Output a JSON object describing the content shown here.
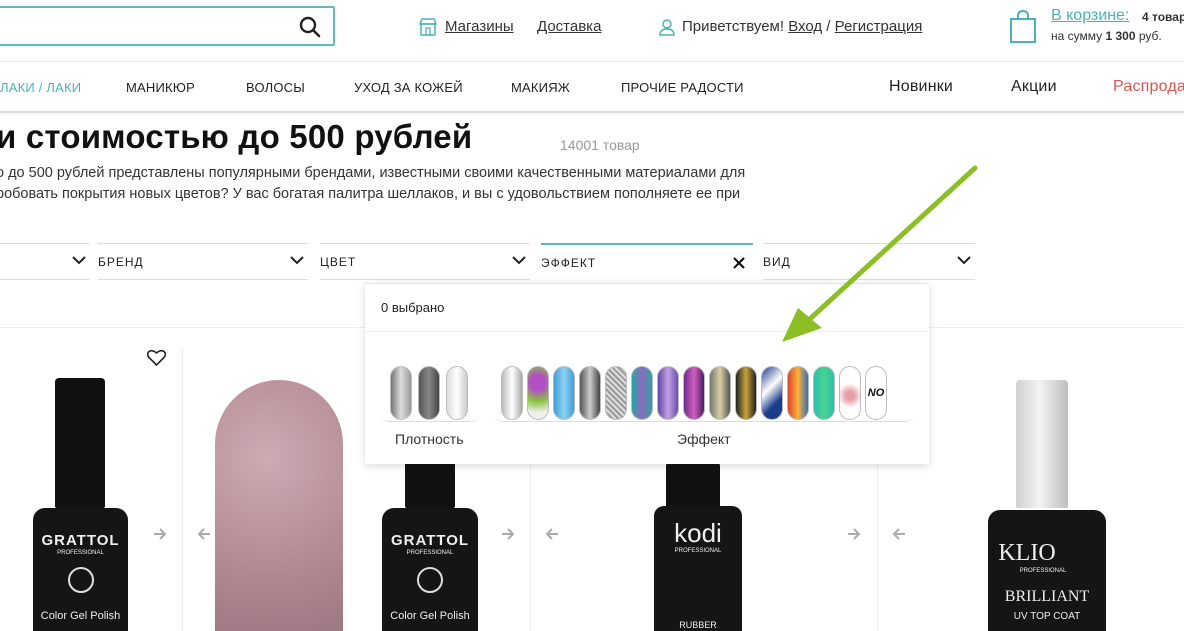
{
  "header": {
    "search_placeholder": "",
    "stores_label": "Магазины",
    "delivery_label": "Доставка",
    "greeting": "Приветствуем!",
    "login_label": "Вход",
    "separator": "/",
    "register_label": "Регистрация",
    "cart_label": "В корзине:",
    "cart_count": "4 товар",
    "cart_sum_prefix": "на сумму",
    "cart_sum": "1 300",
    "cart_sum_suffix": "руб."
  },
  "nav": {
    "items": [
      "ЛАКИ / ЛАКИ",
      "МАНИКЮР",
      "ВОЛОСЫ",
      "УХОД ЗА КОЖЕЙ",
      "МАКИЯЖ",
      "ПРОЧИЕ РАДОСТИ"
    ],
    "right": [
      "Новинки",
      "Акции",
      "Распрода"
    ]
  },
  "page": {
    "title": "и стоимостью до 500 рублей",
    "count": "14001 товар",
    "desc_line1": "о до 500 рублей представлены популярными брендами, известными своими качественными материалами для",
    "desc_line2": "робовать покрытия новых цветов? У вас богатая палитра шеллаков, и вы с удовольствием пополняете ее при"
  },
  "filters": [
    "",
    "БРЕНД",
    "ЦВЕТ",
    "ЭФФЕКТ",
    "ВИД"
  ],
  "dropdown": {
    "selected": "0 выбрано",
    "group1_label": "Плотность",
    "group2_label": "Эффект",
    "no_label": "NO"
  },
  "products": [
    {
      "brand": "GRATTOL",
      "sub": "PROFESSIONAL",
      "product": "Color Gel Polish"
    },
    {
      "brand": "GRATTOL",
      "sub": "PROFESSIONAL",
      "product": "Color Gel Polish"
    },
    {
      "brand": "kodi",
      "sub": "PROFESSIONAL",
      "product": "RUBBER"
    },
    {
      "brand": "KLIO",
      "sub": "PROFESSIONAL",
      "product": "BRILLIANT",
      "product2": "UV TOP COAT"
    }
  ],
  "colors": {
    "accent": "#5bbcbd",
    "link": "#4ab3b5",
    "sale": "#e0534d",
    "arrow": "#8cbf26"
  }
}
